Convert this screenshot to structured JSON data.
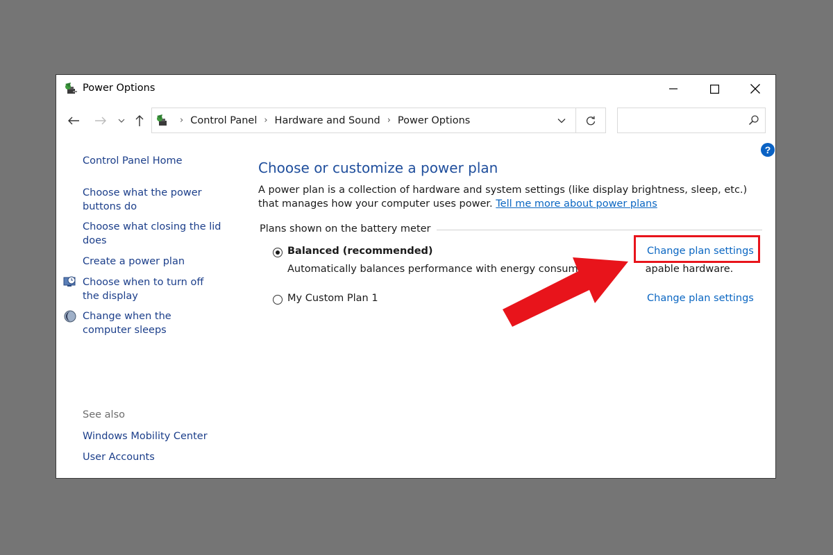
{
  "window": {
    "title": "Power Options",
    "controls": {
      "minimize": "minimize-icon",
      "maximize": "maximize-icon",
      "close": "close-icon"
    }
  },
  "nav": {
    "breadcrumbs": [
      "Control Panel",
      "Hardware and Sound",
      "Power Options"
    ],
    "search_placeholder": ""
  },
  "sidebar": {
    "home": "Control Panel Home",
    "links": [
      "Choose what the power buttons do",
      "Choose what closing the lid does",
      "Create a power plan",
      "Choose when to turn off the display",
      "Change when the computer sleeps"
    ],
    "see_also_label": "See also",
    "see_also": [
      "Windows Mobility Center",
      "User Accounts"
    ]
  },
  "main": {
    "heading": "Choose or customize a power plan",
    "description": "A power plan is a collection of hardware and system settings (like display brightness, sleep, etc.) that manages how your computer uses power.",
    "learn_more_link": "Tell me more about power plans",
    "group_label": "Plans shown on the battery meter",
    "plans": [
      {
        "name": "Balanced (recommended)",
        "selected": true,
        "description": "Automatically balances performance with energy consum",
        "description_tail": "apable hardware.",
        "link": "Change plan settings"
      },
      {
        "name": "My Custom Plan 1",
        "selected": false,
        "link": "Change plan settings"
      }
    ]
  },
  "annotation": {
    "color": "#e8141b"
  }
}
